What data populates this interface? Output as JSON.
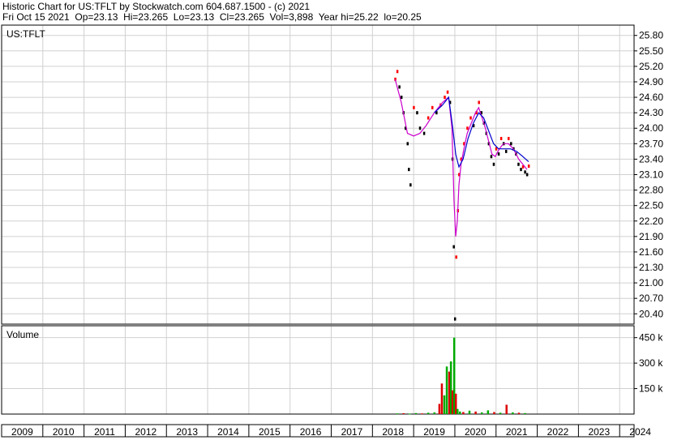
{
  "header": {
    "line1": "Historic Chart for US:TFLT by Stockwatch.com 604.687.1500 - (c) 2021",
    "line2": "Fri Oct 15 2021  Op=23.13  Hi=23.265  Lo=23.13  Cl=23.265  Vol=3,898  Year hi=25.22  lo=20.25"
  },
  "chart_data": {
    "type": "line",
    "symbol_label": "US:TFLT",
    "volume_label": "Volume",
    "x_axis_labels": [
      "2009",
      "2010",
      "2011",
      "2012",
      "2013",
      "2014",
      "2015",
      "2016",
      "2017",
      "2018",
      "2019",
      "2020",
      "2021",
      "2022",
      "2023",
      "2024"
    ],
    "price_axis_labels": [
      "25.80",
      "25.50",
      "25.20",
      "24.90",
      "24.60",
      "24.30",
      "24.00",
      "23.70",
      "23.40",
      "23.10",
      "22.80",
      "22.50",
      "22.20",
      "21.90",
      "21.60",
      "21.30",
      "21.00",
      "20.70",
      "20.40"
    ],
    "volume_axis_labels": [
      "450 k",
      "300 k",
      "150 k"
    ],
    "ylim": [
      20.2,
      26.0
    ],
    "volume_ylim": [
      0,
      520000
    ],
    "xlim": [
      2009.0,
      2024.35
    ],
    "colors": {
      "up_bar": "#ff0000",
      "down_bar": "#000000",
      "ma_short": "#cc00cc",
      "ma_long": "#0000cc",
      "vol_up": "#00aa00",
      "vol_down": "#dd0000",
      "grid": "#d0d0d0"
    },
    "price_series": [
      {
        "x": 2018.55,
        "y": 24.95
      },
      {
        "x": 2018.6,
        "y": 25.1
      },
      {
        "x": 2018.65,
        "y": 24.8
      },
      {
        "x": 2018.7,
        "y": 24.6
      },
      {
        "x": 2018.75,
        "y": 24.3
      },
      {
        "x": 2018.8,
        "y": 24.0
      },
      {
        "x": 2018.85,
        "y": 23.7
      },
      {
        "x": 2018.88,
        "y": 23.2
      },
      {
        "x": 2018.92,
        "y": 22.9
      },
      {
        "x": 2019.0,
        "y": 24.4
      },
      {
        "x": 2019.08,
        "y": 24.3
      },
      {
        "x": 2019.15,
        "y": 24.0
      },
      {
        "x": 2019.25,
        "y": 23.9
      },
      {
        "x": 2019.35,
        "y": 24.2
      },
      {
        "x": 2019.45,
        "y": 24.4
      },
      {
        "x": 2019.55,
        "y": 24.3
      },
      {
        "x": 2019.65,
        "y": 24.45
      },
      {
        "x": 2019.75,
        "y": 24.6
      },
      {
        "x": 2019.82,
        "y": 24.7
      },
      {
        "x": 2019.88,
        "y": 24.5
      },
      {
        "x": 2019.94,
        "y": 23.4
      },
      {
        "x": 2019.97,
        "y": 21.7
      },
      {
        "x": 2020.0,
        "y": 20.3
      },
      {
        "x": 2020.03,
        "y": 21.5
      },
      {
        "x": 2020.07,
        "y": 22.4
      },
      {
        "x": 2020.1,
        "y": 23.1
      },
      {
        "x": 2020.15,
        "y": 23.4
      },
      {
        "x": 2020.22,
        "y": 23.7
      },
      {
        "x": 2020.3,
        "y": 24.0
      },
      {
        "x": 2020.38,
        "y": 24.2
      },
      {
        "x": 2020.45,
        "y": 24.05
      },
      {
        "x": 2020.52,
        "y": 24.3
      },
      {
        "x": 2020.58,
        "y": 24.5
      },
      {
        "x": 2020.64,
        "y": 24.3
      },
      {
        "x": 2020.7,
        "y": 24.1
      },
      {
        "x": 2020.76,
        "y": 23.9
      },
      {
        "x": 2020.82,
        "y": 23.7
      },
      {
        "x": 2020.88,
        "y": 23.45
      },
      {
        "x": 2020.94,
        "y": 23.3
      },
      {
        "x": 2021.0,
        "y": 23.6
      },
      {
        "x": 2021.06,
        "y": 23.5
      },
      {
        "x": 2021.12,
        "y": 23.8
      },
      {
        "x": 2021.18,
        "y": 23.7
      },
      {
        "x": 2021.24,
        "y": 23.55
      },
      {
        "x": 2021.3,
        "y": 23.8
      },
      {
        "x": 2021.36,
        "y": 23.7
      },
      {
        "x": 2021.42,
        "y": 23.6
      },
      {
        "x": 2021.48,
        "y": 23.5
      },
      {
        "x": 2021.54,
        "y": 23.3
      },
      {
        "x": 2021.6,
        "y": 23.2
      },
      {
        "x": 2021.65,
        "y": 23.25
      },
      {
        "x": 2021.7,
        "y": 23.15
      },
      {
        "x": 2021.75,
        "y": 23.1
      },
      {
        "x": 2021.79,
        "y": 23.265
      }
    ],
    "ma_short": [
      {
        "x": 2018.55,
        "y": 24.95
      },
      {
        "x": 2018.7,
        "y": 24.5
      },
      {
        "x": 2018.85,
        "y": 23.9
      },
      {
        "x": 2019.0,
        "y": 23.85
      },
      {
        "x": 2019.15,
        "y": 23.9
      },
      {
        "x": 2019.3,
        "y": 24.05
      },
      {
        "x": 2019.5,
        "y": 24.3
      },
      {
        "x": 2019.7,
        "y": 24.5
      },
      {
        "x": 2019.85,
        "y": 24.6
      },
      {
        "x": 2019.93,
        "y": 24.0
      },
      {
        "x": 2019.98,
        "y": 22.6
      },
      {
        "x": 2020.02,
        "y": 21.9
      },
      {
        "x": 2020.06,
        "y": 22.2
      },
      {
        "x": 2020.1,
        "y": 22.9
      },
      {
        "x": 2020.15,
        "y": 23.3
      },
      {
        "x": 2020.22,
        "y": 23.6
      },
      {
        "x": 2020.3,
        "y": 23.9
      },
      {
        "x": 2020.4,
        "y": 24.1
      },
      {
        "x": 2020.5,
        "y": 24.3
      },
      {
        "x": 2020.58,
        "y": 24.4
      },
      {
        "x": 2020.66,
        "y": 24.2
      },
      {
        "x": 2020.74,
        "y": 24.0
      },
      {
        "x": 2020.82,
        "y": 23.75
      },
      {
        "x": 2020.9,
        "y": 23.5
      },
      {
        "x": 2020.98,
        "y": 23.45
      },
      {
        "x": 2021.08,
        "y": 23.6
      },
      {
        "x": 2021.18,
        "y": 23.7
      },
      {
        "x": 2021.3,
        "y": 23.7
      },
      {
        "x": 2021.42,
        "y": 23.6
      },
      {
        "x": 2021.55,
        "y": 23.4
      },
      {
        "x": 2021.65,
        "y": 23.3
      },
      {
        "x": 2021.75,
        "y": 23.2
      }
    ],
    "ma_long": [
      {
        "x": 2019.5,
        "y": 24.3
      },
      {
        "x": 2019.7,
        "y": 24.45
      },
      {
        "x": 2019.85,
        "y": 24.6
      },
      {
        "x": 2019.95,
        "y": 24.0
      },
      {
        "x": 2020.02,
        "y": 23.5
      },
      {
        "x": 2020.1,
        "y": 23.25
      },
      {
        "x": 2020.2,
        "y": 23.4
      },
      {
        "x": 2020.32,
        "y": 23.8
      },
      {
        "x": 2020.45,
        "y": 24.1
      },
      {
        "x": 2020.58,
        "y": 24.3
      },
      {
        "x": 2020.7,
        "y": 24.2
      },
      {
        "x": 2020.82,
        "y": 23.95
      },
      {
        "x": 2020.94,
        "y": 23.7
      },
      {
        "x": 2021.06,
        "y": 23.6
      },
      {
        "x": 2021.2,
        "y": 23.6
      },
      {
        "x": 2021.35,
        "y": 23.6
      },
      {
        "x": 2021.5,
        "y": 23.55
      },
      {
        "x": 2021.65,
        "y": 23.45
      },
      {
        "x": 2021.79,
        "y": 23.35
      }
    ],
    "volume_bars": [
      {
        "x": 2018.6,
        "v": 4000,
        "up": true
      },
      {
        "x": 2018.75,
        "v": 5000,
        "up": false
      },
      {
        "x": 2018.9,
        "v": 3000,
        "up": true
      },
      {
        "x": 2019.05,
        "v": 6000,
        "up": true
      },
      {
        "x": 2019.2,
        "v": 4000,
        "up": false
      },
      {
        "x": 2019.35,
        "v": 8000,
        "up": true
      },
      {
        "x": 2019.5,
        "v": 10000,
        "up": true
      },
      {
        "x": 2019.62,
        "v": 60000,
        "up": false
      },
      {
        "x": 2019.68,
        "v": 180000,
        "up": false
      },
      {
        "x": 2019.74,
        "v": 110000,
        "up": true
      },
      {
        "x": 2019.8,
        "v": 280000,
        "up": true
      },
      {
        "x": 2019.86,
        "v": 250000,
        "up": false
      },
      {
        "x": 2019.9,
        "v": 310000,
        "up": true
      },
      {
        "x": 2019.94,
        "v": 140000,
        "up": false
      },
      {
        "x": 2019.98,
        "v": 450000,
        "up": true
      },
      {
        "x": 2020.02,
        "v": 120000,
        "up": false
      },
      {
        "x": 2020.06,
        "v": 30000,
        "up": true
      },
      {
        "x": 2020.12,
        "v": 15000,
        "up": true
      },
      {
        "x": 2020.2,
        "v": 12000,
        "up": false
      },
      {
        "x": 2020.35,
        "v": 20000,
        "up": true
      },
      {
        "x": 2020.5,
        "v": 15000,
        "up": false
      },
      {
        "x": 2020.65,
        "v": 10000,
        "up": true
      },
      {
        "x": 2020.8,
        "v": 22000,
        "up": true
      },
      {
        "x": 2020.95,
        "v": 12000,
        "up": false
      },
      {
        "x": 2021.1,
        "v": 8000,
        "up": true
      },
      {
        "x": 2021.25,
        "v": 55000,
        "up": false
      },
      {
        "x": 2021.4,
        "v": 10000,
        "up": true
      },
      {
        "x": 2021.55,
        "v": 8000,
        "up": false
      },
      {
        "x": 2021.7,
        "v": 6000,
        "up": true
      }
    ]
  }
}
